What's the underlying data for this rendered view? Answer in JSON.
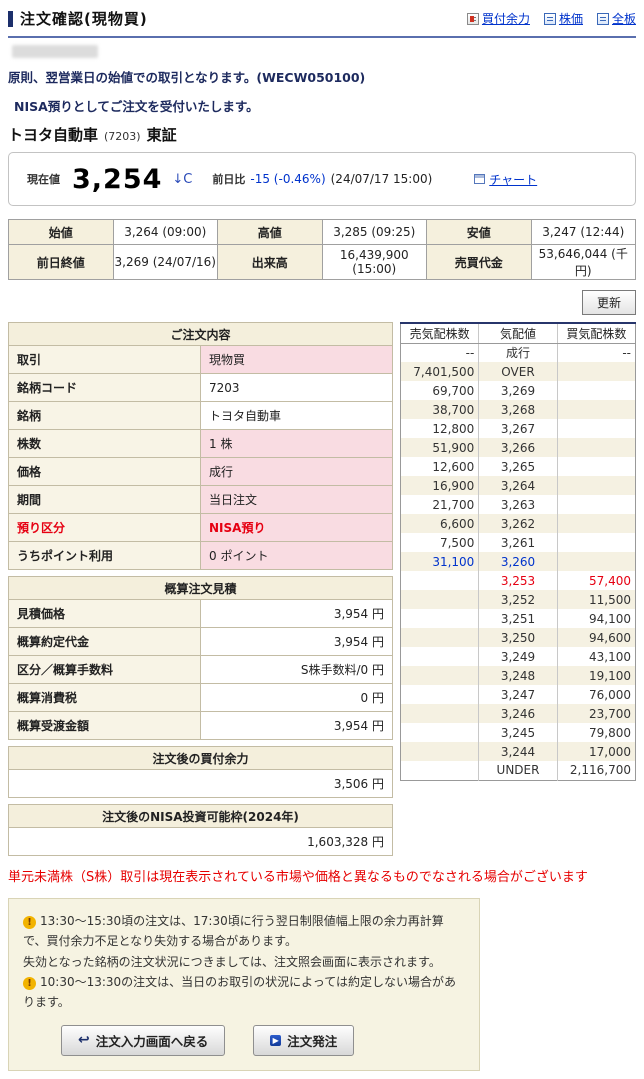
{
  "page": {
    "title": "注文確認(現物買)"
  },
  "header_links": [
    {
      "id": "buying-power",
      "label": "買付余力",
      "icon": "buying-power-icon",
      "icon_class": "icon-funds"
    },
    {
      "id": "stock-price",
      "label": "株価",
      "icon": "stock-price-icon",
      "icon_class": "icon-doc"
    },
    {
      "id": "full-board",
      "label": "全板",
      "icon": "full-board-icon",
      "icon_class": "icon-doc"
    }
  ],
  "messages": {
    "notice1": "原則、翌営業日の始値での取引となります。(WECW050100)",
    "notice2": "NISA預りとしてご注文を受付いたします。"
  },
  "stock": {
    "name": "トヨタ自動車",
    "code": "(7203)",
    "market": "東証"
  },
  "price_panel": {
    "current_label": "現在値",
    "current_value": "3,254",
    "direction": "↓C",
    "change_label": "前日比",
    "change_value": "-15 (-0.46%)",
    "timestamp": "(24/07/17 15:00)",
    "chart_link": "チャート"
  },
  "quote_table": {
    "rows": [
      [
        {
          "label": "始値",
          "value": "3,264 (09:00)"
        },
        {
          "label": "高値",
          "value": "3,285 (09:25)"
        },
        {
          "label": "安値",
          "value": "3,247 (12:44)"
        }
      ],
      [
        {
          "label": "前日終値",
          "value": "3,269 (24/07/16)"
        },
        {
          "label": "出来高",
          "value": "16,439,900 (15:00)"
        },
        {
          "label": "売買代金",
          "value": "53,646,044 (千円)"
        }
      ]
    ]
  },
  "refresh_button": "更新",
  "order_details": {
    "title": "ご注文内容",
    "rows": [
      {
        "label": "取引",
        "value": "現物買",
        "highlight": true
      },
      {
        "label": "銘柄コード",
        "value": "7203",
        "highlight": false
      },
      {
        "label": "銘柄",
        "value": "トヨタ自動車",
        "highlight": false
      },
      {
        "label": "株数",
        "value": "1 株",
        "highlight": true
      },
      {
        "label": "価格",
        "value": "成行",
        "highlight": true
      },
      {
        "label": "期間",
        "value": "当日注文",
        "highlight": true
      },
      {
        "label": "預り区分",
        "value": "NISA預り",
        "highlight": true,
        "red": true
      },
      {
        "label": "うちポイント利用",
        "value": "0 ポイント",
        "highlight": true
      }
    ]
  },
  "estimate": {
    "title": "概算注文見積",
    "rows": [
      {
        "label": "見積価格",
        "value": "3,954 円"
      },
      {
        "label": "概算約定代金",
        "value": "3,954 円"
      },
      {
        "label": "区分／概算手数料",
        "value": "S株手数料/0 円"
      },
      {
        "label": "概算消費税",
        "value": "0 円"
      },
      {
        "label": "概算受渡金額",
        "value": "3,954 円"
      }
    ]
  },
  "buying_power": {
    "title": "注文後の買付余力",
    "value": "3,506 円"
  },
  "nisa_limit": {
    "title": "注文後のNISA投資可能枠(2024年)",
    "value": "1,603,328 円"
  },
  "orderbook": {
    "headers": [
      "売気配株数",
      "気配値",
      "買気配株数"
    ],
    "rows": [
      {
        "sell": "--",
        "price": "成行",
        "buy": "--"
      },
      {
        "sell": "7,401,500",
        "price": "OVER",
        "buy": ""
      },
      {
        "sell": "69,700",
        "price": "3,269",
        "buy": ""
      },
      {
        "sell": "38,700",
        "price": "3,268",
        "buy": ""
      },
      {
        "sell": "12,800",
        "price": "3,267",
        "buy": ""
      },
      {
        "sell": "51,900",
        "price": "3,266",
        "buy": ""
      },
      {
        "sell": "12,600",
        "price": "3,265",
        "buy": ""
      },
      {
        "sell": "16,900",
        "price": "3,264",
        "buy": ""
      },
      {
        "sell": "21,700",
        "price": "3,263",
        "buy": ""
      },
      {
        "sell": "6,600",
        "price": "3,262",
        "buy": ""
      },
      {
        "sell": "7,500",
        "price": "3,261",
        "buy": ""
      },
      {
        "sell": "31,100",
        "price": "3,260",
        "buy": "",
        "cls": "best-ask"
      },
      {
        "sell": "",
        "price": "3,253",
        "buy": "57,400",
        "cls": "last-trade"
      },
      {
        "sell": "",
        "price": "3,252",
        "buy": "11,500"
      },
      {
        "sell": "",
        "price": "3,251",
        "buy": "94,100"
      },
      {
        "sell": "",
        "price": "3,250",
        "buy": "94,600"
      },
      {
        "sell": "",
        "price": "3,249",
        "buy": "43,100"
      },
      {
        "sell": "",
        "price": "3,248",
        "buy": "19,100"
      },
      {
        "sell": "",
        "price": "3,247",
        "buy": "76,000"
      },
      {
        "sell": "",
        "price": "3,246",
        "buy": "23,700"
      },
      {
        "sell": "",
        "price": "3,245",
        "buy": "79,800"
      },
      {
        "sell": "",
        "price": "3,244",
        "buy": "17,000"
      },
      {
        "sell": "",
        "price": "UNDER",
        "buy": "2,116,700"
      }
    ]
  },
  "warning_red": "単元未満株（S株）取引は現在表示されている市場や価格と異なるものでなされる場合がございます",
  "notice_box": {
    "lines": [
      {
        "icon": true,
        "text": "13:30～15:30頃の注文は、17:30頃に行う翌日制限値幅上限の余力再計算で、買付余力不足となり失効する場合があります。"
      },
      {
        "icon": false,
        "text": "失効となった銘柄の注文状況につきましては、注文照会画面に表示されます。"
      },
      {
        "icon": true,
        "text": "10:30～13:30の注文は、当日のお取引の状況によっては約定しない場合があります。"
      }
    ],
    "back_button": "注文入力画面へ戻る",
    "submit_button": "注文発注"
  }
}
